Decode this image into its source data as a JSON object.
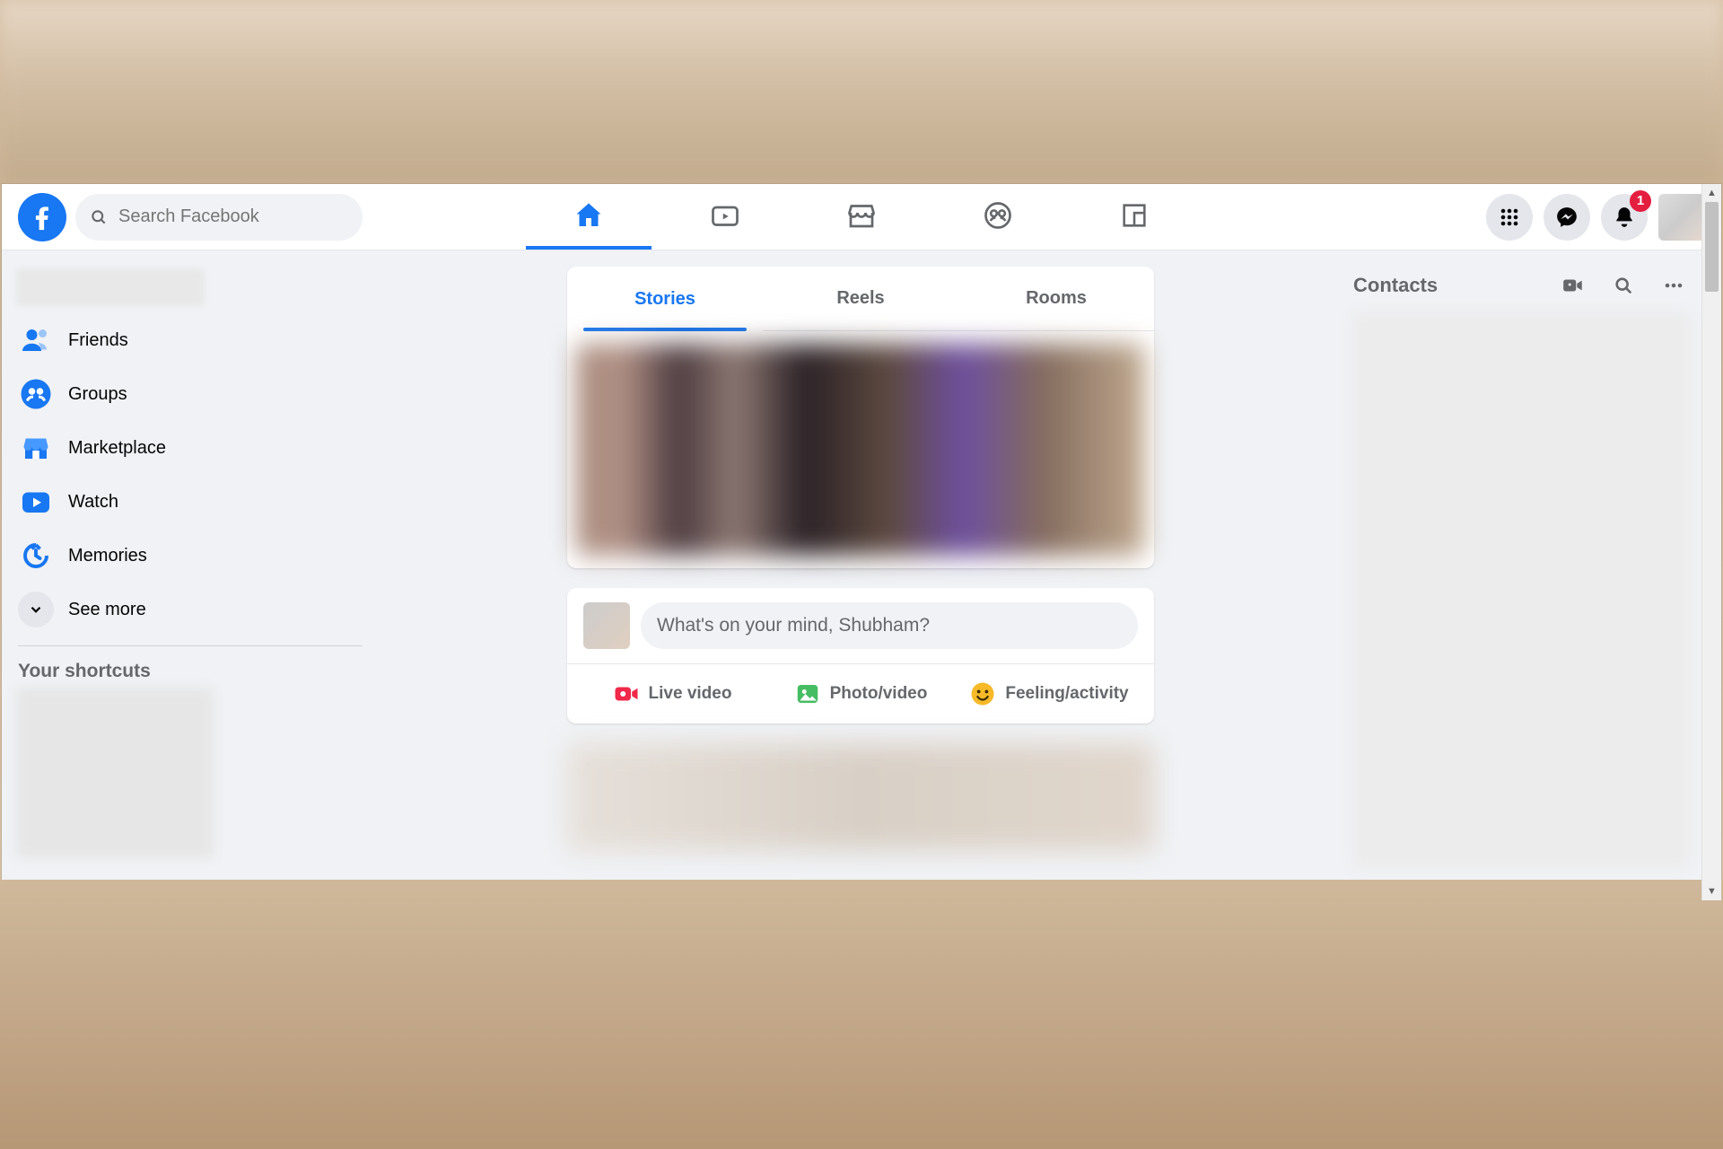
{
  "header": {
    "search_placeholder": "Search Facebook",
    "notifications_count": "1"
  },
  "left_nav": {
    "friends": "Friends",
    "groups": "Groups",
    "marketplace": "Marketplace",
    "watch": "Watch",
    "memories": "Memories",
    "see_more": "See more",
    "shortcuts_title": "Your shortcuts"
  },
  "stories": {
    "tab_stories": "Stories",
    "tab_reels": "Reels",
    "tab_rooms": "Rooms"
  },
  "composer": {
    "placeholder": "What's on your mind, Shubham?",
    "live_video": "Live video",
    "photo_video": "Photo/video",
    "feeling": "Feeling/activity"
  },
  "contacts": {
    "title": "Contacts"
  },
  "colors": {
    "brand": "#1877f2",
    "badge": "#e41e3f",
    "icon_gray": "#65676b"
  }
}
